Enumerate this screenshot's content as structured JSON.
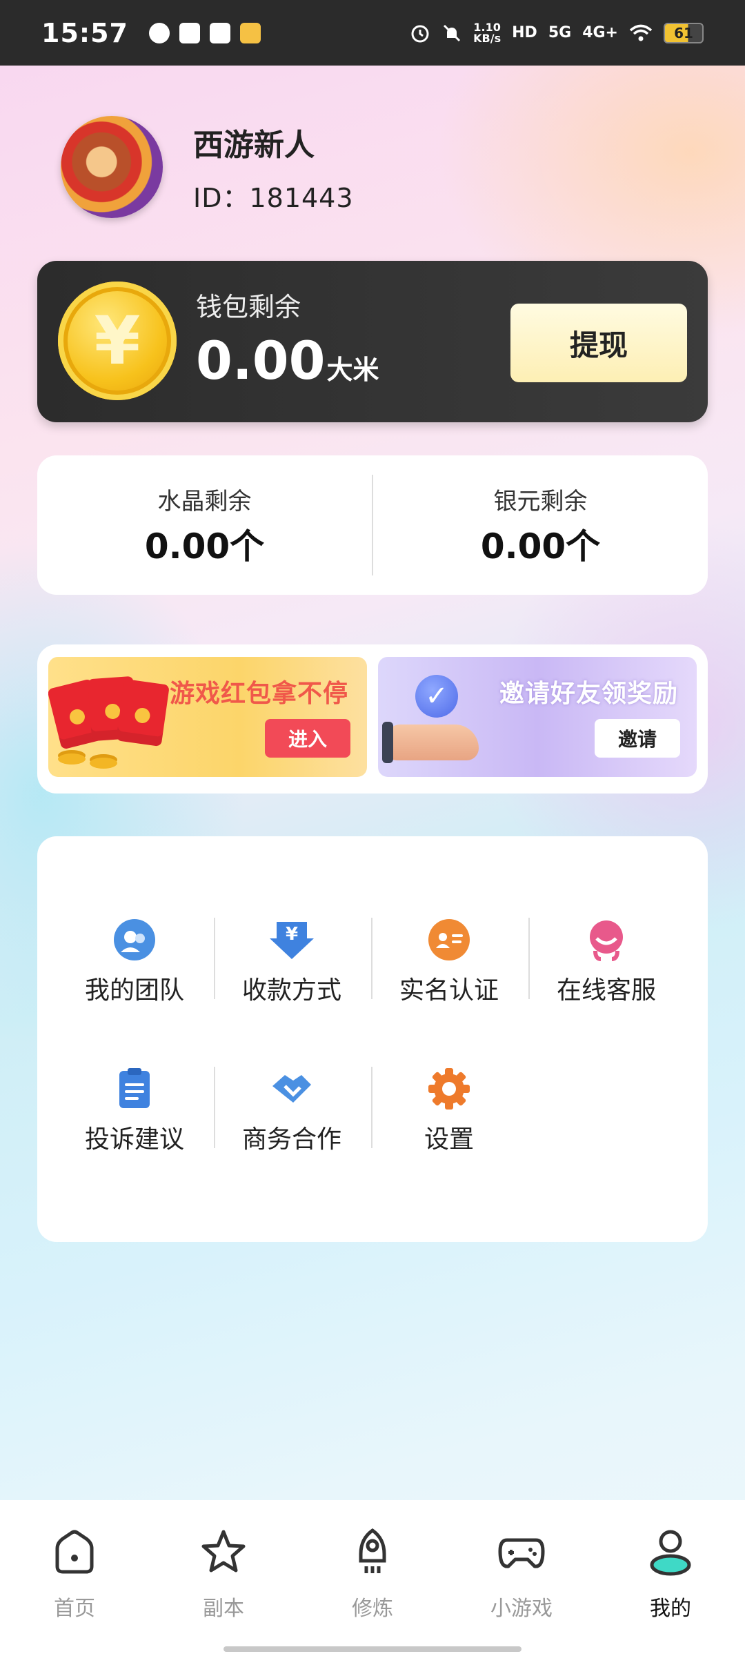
{
  "status_bar": {
    "time": "15:57",
    "net_speed_value": "1.10",
    "net_speed_unit": "KB/s",
    "hd_label": "HD",
    "sim1": "5G",
    "sim2": "4G+",
    "battery": "61",
    "icons": [
      "check-circle-icon",
      "inbox-icon",
      "baidu-icon",
      "weibo-icon",
      "alarm-icon",
      "bell-muted-icon",
      "signal-icon",
      "wifi-icon",
      "battery-icon"
    ]
  },
  "profile": {
    "username": "西游新人",
    "user_id": "ID：181443"
  },
  "wallet": {
    "label": "钱包剩余",
    "amount": "0.00",
    "unit": "大米",
    "withdraw_label": "提现",
    "coin_symbol": "¥"
  },
  "balances": [
    {
      "label": "水晶剩余",
      "value": "0.00个"
    },
    {
      "label": "银元剩余",
      "value": "0.00个"
    }
  ],
  "promos": [
    {
      "title": "游戏红包拿不停",
      "button": "进入"
    },
    {
      "title": "邀请好友领奖励",
      "button": "邀请"
    }
  ],
  "menu": [
    {
      "label": "我的团队",
      "icon": "team-icon"
    },
    {
      "label": "收款方式",
      "icon": "payment-icon"
    },
    {
      "label": "实名认证",
      "icon": "id-card-icon"
    },
    {
      "label": "在线客服",
      "icon": "customer-service-icon"
    },
    {
      "label": "投诉建议",
      "icon": "feedback-icon"
    },
    {
      "label": "商务合作",
      "icon": "handshake-icon"
    },
    {
      "label": "设置",
      "icon": "gear-icon"
    }
  ],
  "tabs": [
    {
      "label": "首页",
      "icon": "home-icon",
      "active": false
    },
    {
      "label": "副本",
      "icon": "star-icon",
      "active": false
    },
    {
      "label": "修炼",
      "icon": "rocket-icon",
      "active": false
    },
    {
      "label": "小游戏",
      "icon": "gamepad-icon",
      "active": false
    },
    {
      "label": "我的",
      "icon": "user-icon",
      "active": true
    }
  ],
  "colors": {
    "accent_red": "#f24a57",
    "wallet_dark": "#2c2c2c",
    "withdraw_bg": "#fdefb4",
    "active_tab": "#3fd9c6"
  }
}
